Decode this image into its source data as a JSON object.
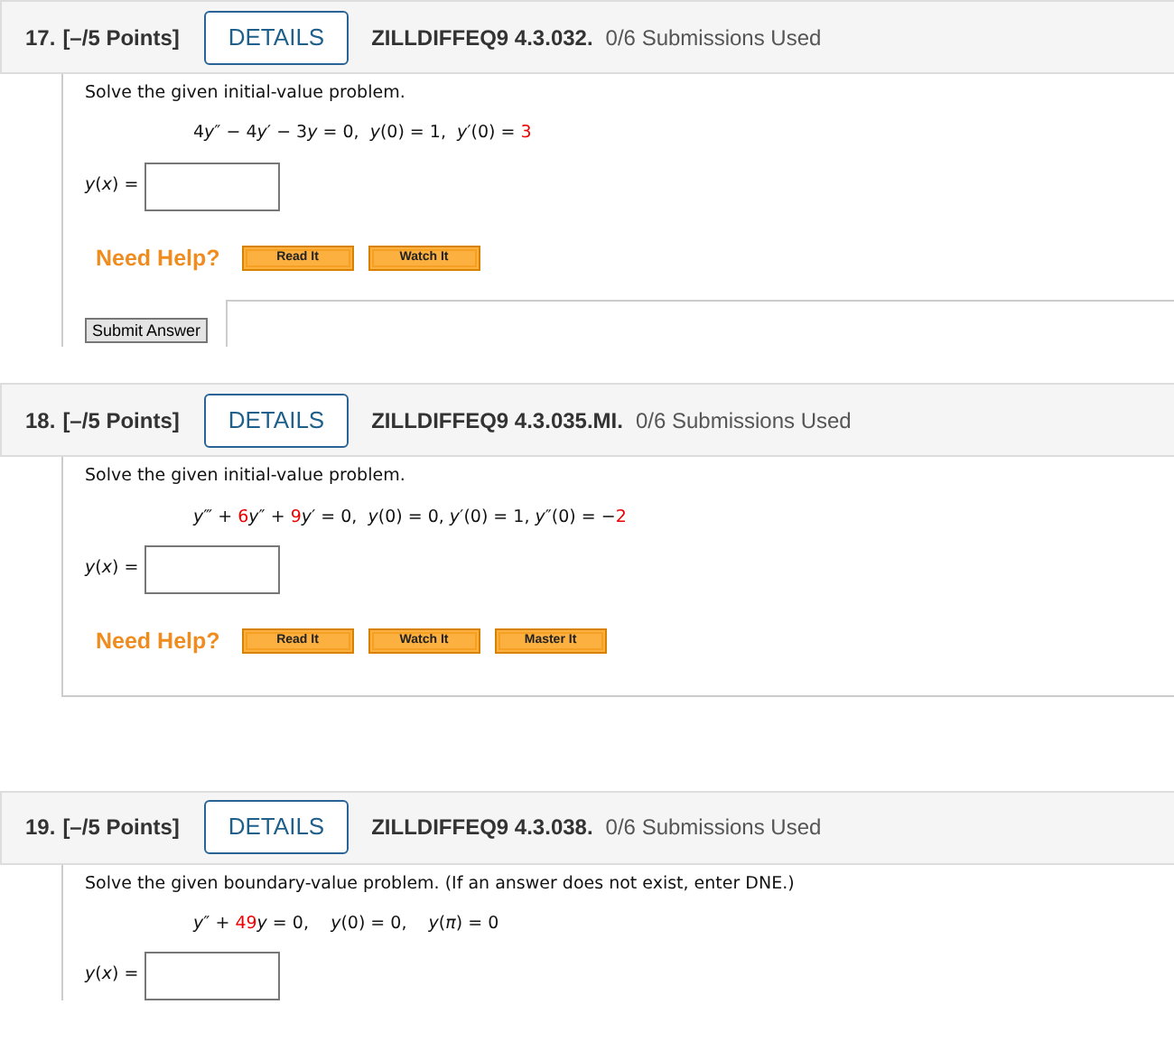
{
  "questions": [
    {
      "number": "17.",
      "points": "[–/5 Points]",
      "details_button": "DETAILS",
      "code": "ZILLDIFFEQ9 4.3.032.",
      "submissions": "0/6 Submissions Used",
      "prompt": "Solve the given initial-value problem.",
      "equation": [
        {
          "kind": "plain",
          "text": "4"
        },
        {
          "kind": "var",
          "text": "y"
        },
        {
          "kind": "plain",
          "text": "″ − 4"
        },
        {
          "kind": "var",
          "text": "y"
        },
        {
          "kind": "plain",
          "text": "′ − 3"
        },
        {
          "kind": "var",
          "text": "y"
        },
        {
          "kind": "plain",
          "text": " = 0,  "
        },
        {
          "kind": "var",
          "text": "y"
        },
        {
          "kind": "plain",
          "text": "(0) = 1,  "
        },
        {
          "kind": "var",
          "text": "y"
        },
        {
          "kind": "plain",
          "text": "′(0) = "
        },
        {
          "kind": "coef",
          "text": "3"
        }
      ],
      "answer_label": "*y*(*x*) =",
      "need_help": "Need Help?",
      "help_buttons": [
        "Read It",
        "Watch It"
      ],
      "submit_button": "Submit Answer"
    },
    {
      "number": "18.",
      "points": "[–/5 Points]",
      "details_button": "DETAILS",
      "code": "ZILLDIFFEQ9 4.3.035.MI.",
      "submissions": "0/6 Submissions Used",
      "prompt": "Solve the given initial-value problem.",
      "equation": [
        {
          "kind": "var",
          "text": "y"
        },
        {
          "kind": "plain",
          "text": "‴ + "
        },
        {
          "kind": "coef",
          "text": "6"
        },
        {
          "kind": "var",
          "text": "y"
        },
        {
          "kind": "plain",
          "text": "″ + "
        },
        {
          "kind": "coef",
          "text": "9"
        },
        {
          "kind": "var",
          "text": "y"
        },
        {
          "kind": "plain",
          "text": "′ = 0,  "
        },
        {
          "kind": "var",
          "text": "y"
        },
        {
          "kind": "plain",
          "text": "(0) = 0, "
        },
        {
          "kind": "var",
          "text": "y"
        },
        {
          "kind": "plain",
          "text": "′(0) = 1, "
        },
        {
          "kind": "var",
          "text": "y"
        },
        {
          "kind": "plain",
          "text": "″(0) = −"
        },
        {
          "kind": "coef",
          "text": "2"
        }
      ],
      "answer_label": "*y*(*x*) =",
      "need_help": "Need Help?",
      "help_buttons": [
        "Read It",
        "Watch It",
        "Master It"
      ]
    },
    {
      "number": "19.",
      "points": "[–/5 Points]",
      "details_button": "DETAILS",
      "code": "ZILLDIFFEQ9 4.3.038.",
      "submissions": "0/6 Submissions Used",
      "prompt": "Solve the given boundary-value problem. (If an answer does not exist, enter DNE.)",
      "equation": [
        {
          "kind": "var",
          "text": "y"
        },
        {
          "kind": "plain",
          "text": "″ + "
        },
        {
          "kind": "coef",
          "text": "49"
        },
        {
          "kind": "var",
          "text": "y"
        },
        {
          "kind": "plain",
          "text": " = 0,    "
        },
        {
          "kind": "var",
          "text": "y"
        },
        {
          "kind": "plain",
          "text": "(0) = 0,    "
        },
        {
          "kind": "var",
          "text": "y"
        },
        {
          "kind": "plain",
          "text": "("
        },
        {
          "kind": "var",
          "text": "π"
        },
        {
          "kind": "plain",
          "text": ") = 0"
        }
      ],
      "answer_label": "*y*(*x*) ="
    }
  ]
}
